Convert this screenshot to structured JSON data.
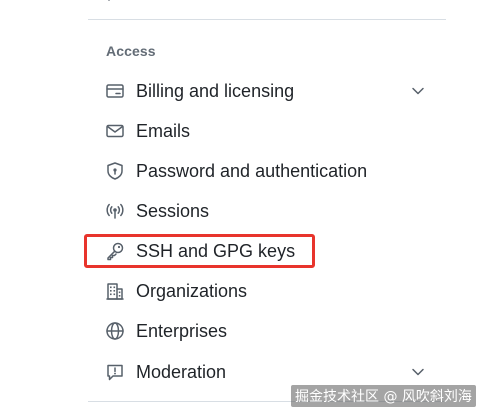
{
  "sidebar": {
    "section_title": "Access",
    "items": [
      {
        "label": "Billing and licensing",
        "icon": "credit-card-icon",
        "has_chevron": true
      },
      {
        "label": "Emails",
        "icon": "mail-icon",
        "has_chevron": false
      },
      {
        "label": "Password and authentication",
        "icon": "shield-lock-icon",
        "has_chevron": false
      },
      {
        "label": "Sessions",
        "icon": "broadcast-icon",
        "has_chevron": false
      },
      {
        "label": "SSH and GPG keys",
        "icon": "key-icon",
        "has_chevron": false,
        "highlighted": true
      },
      {
        "label": "Organizations",
        "icon": "organization-icon",
        "has_chevron": false
      },
      {
        "label": "Enterprises",
        "icon": "globe-icon",
        "has_chevron": false
      },
      {
        "label": "Moderation",
        "icon": "report-icon",
        "has_chevron": true
      }
    ]
  },
  "highlight_color": "#e8342c",
  "watermark": "掘金技术社区 @ 风吹斜刘海"
}
